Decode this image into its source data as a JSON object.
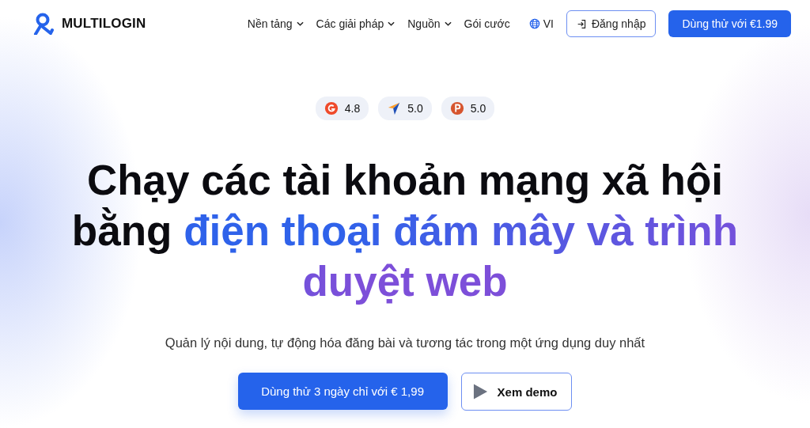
{
  "brand": {
    "name": "MULTILOGIN"
  },
  "nav": [
    {
      "label": "Nền tảng",
      "dropdown": true
    },
    {
      "label": "Các giải pháp",
      "dropdown": true
    },
    {
      "label": "Nguồn",
      "dropdown": true
    },
    {
      "label": "Gói cước",
      "dropdown": false
    }
  ],
  "language": "VI",
  "login_button": "Đăng nhập",
  "trial_button": "Dùng thử với €1.99",
  "ratings": [
    {
      "kind": "g2",
      "score": "4.8"
    },
    {
      "kind": "capterra",
      "score": "5.0"
    },
    {
      "kind": "producthunt",
      "score": "5.0"
    }
  ],
  "headline": [
    {
      "text": "Chạy các tài khoản mạng xã hội bằng ",
      "highlight": false
    },
    {
      "text": "điện thoại đám mây và trình duyệt web",
      "highlight": true
    }
  ],
  "subtitle": "Quản lý nội dung, tự động hóa đăng bài và tương tác trong một ứng dụng duy nhất",
  "cta_primary": "Dùng thử 3 ngày chỉ với € 1,99",
  "cta_secondary": "Xem demo"
}
